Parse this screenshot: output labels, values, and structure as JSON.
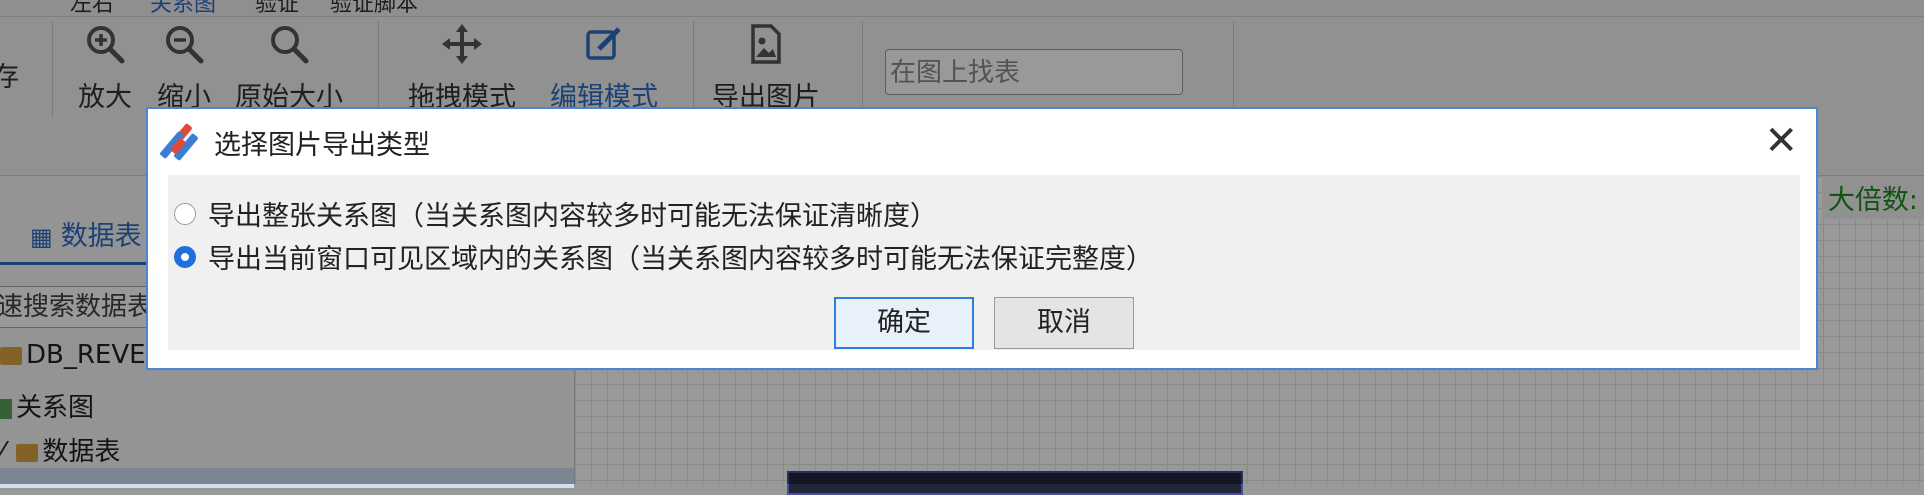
{
  "app": {
    "menu_tabs": [
      "左右",
      "关系图",
      "验证",
      "验证脚本"
    ],
    "ribbon": {
      "save_label": "存",
      "zoom_in": "放大",
      "zoom_out": "缩小",
      "original_size": "原始大小",
      "drag_mode": "拖拽模式",
      "edit_mode": "编辑模式",
      "export_image": "导出图片",
      "find_placeholder": "在图上找表"
    },
    "left_panel": {
      "tab_label": "数据表",
      "search_text": "速搜索数据表",
      "tree": {
        "db": "DB_REVE",
        "relation": "关系图",
        "tables": "数据表"
      }
    },
    "canvas": {
      "zoom_label": "大倍数:"
    }
  },
  "dialog": {
    "title": "选择图片导出类型",
    "options": [
      {
        "label": "导出整张关系图（当关系图内容较多时可能无法保证清晰度）",
        "selected": false
      },
      {
        "label": "导出当前窗口可见区域内的关系图（当关系图内容较多时可能无法保证完整度）",
        "selected": true
      }
    ],
    "ok_label": "确定",
    "cancel_label": "取消"
  },
  "colors": {
    "accent": "#2f6fc4",
    "radio_selected": "#1f6fde",
    "zoom_label": "#1f8a1f",
    "dialog_border": "#4a86d4"
  },
  "icons": {
    "zoom_in": "zoom-in-icon",
    "zoom_out": "zoom-out-icon",
    "original_size": "search-icon",
    "drag_mode": "move-arrows-icon",
    "edit_mode": "pencil-edit-icon",
    "export_image": "image-file-icon",
    "close": "close-icon"
  }
}
